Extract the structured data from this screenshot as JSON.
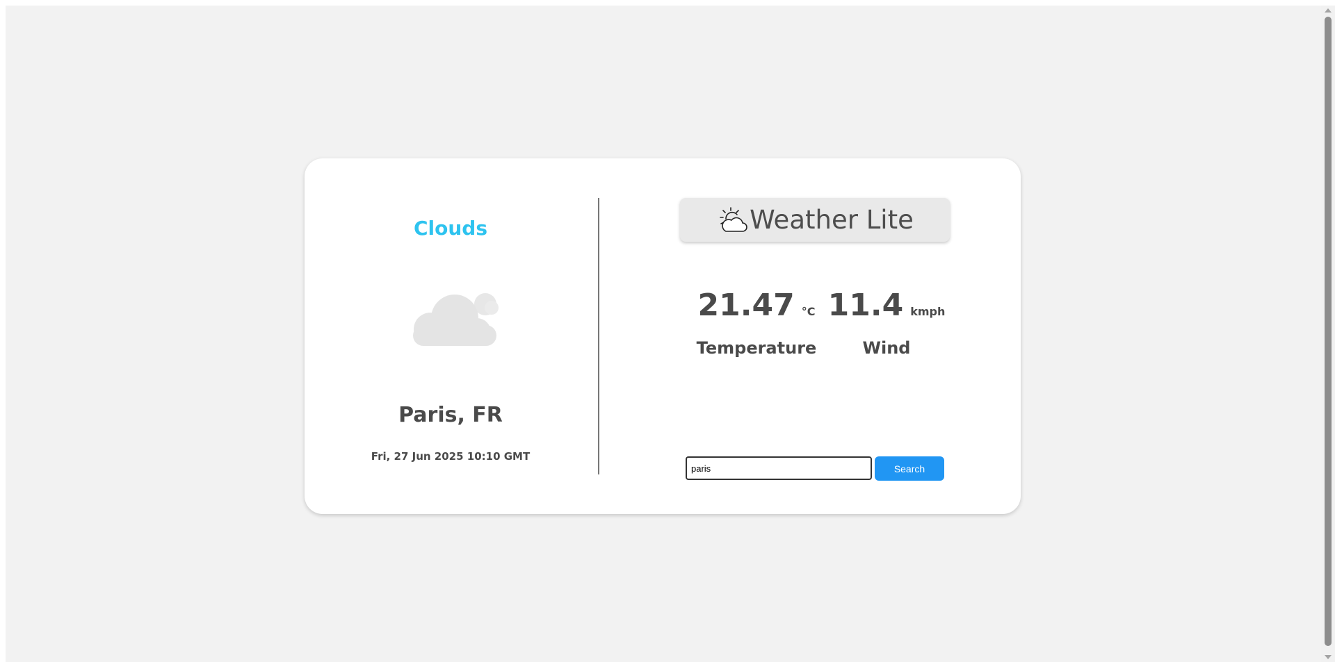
{
  "weather": {
    "condition": "Clouds",
    "location": "Paris, FR",
    "datetime": "Fri, 27 Jun 2025 10:10 GMT",
    "icon": "cloud-icon"
  },
  "brand": {
    "title": "Weather Lite",
    "icon": "sun-cloud-icon"
  },
  "metrics": {
    "temperature": {
      "value": "21.47",
      "unit": "°C",
      "label": "Temperature"
    },
    "wind": {
      "value": "11.4",
      "unit": "kmph",
      "label": "Wind"
    }
  },
  "search": {
    "value": "paris",
    "button_label": "Search"
  },
  "colors": {
    "accent": "#2ec3ef",
    "button": "#2196f3",
    "background": "#f2f2f2",
    "text": "#4a4a4a"
  }
}
